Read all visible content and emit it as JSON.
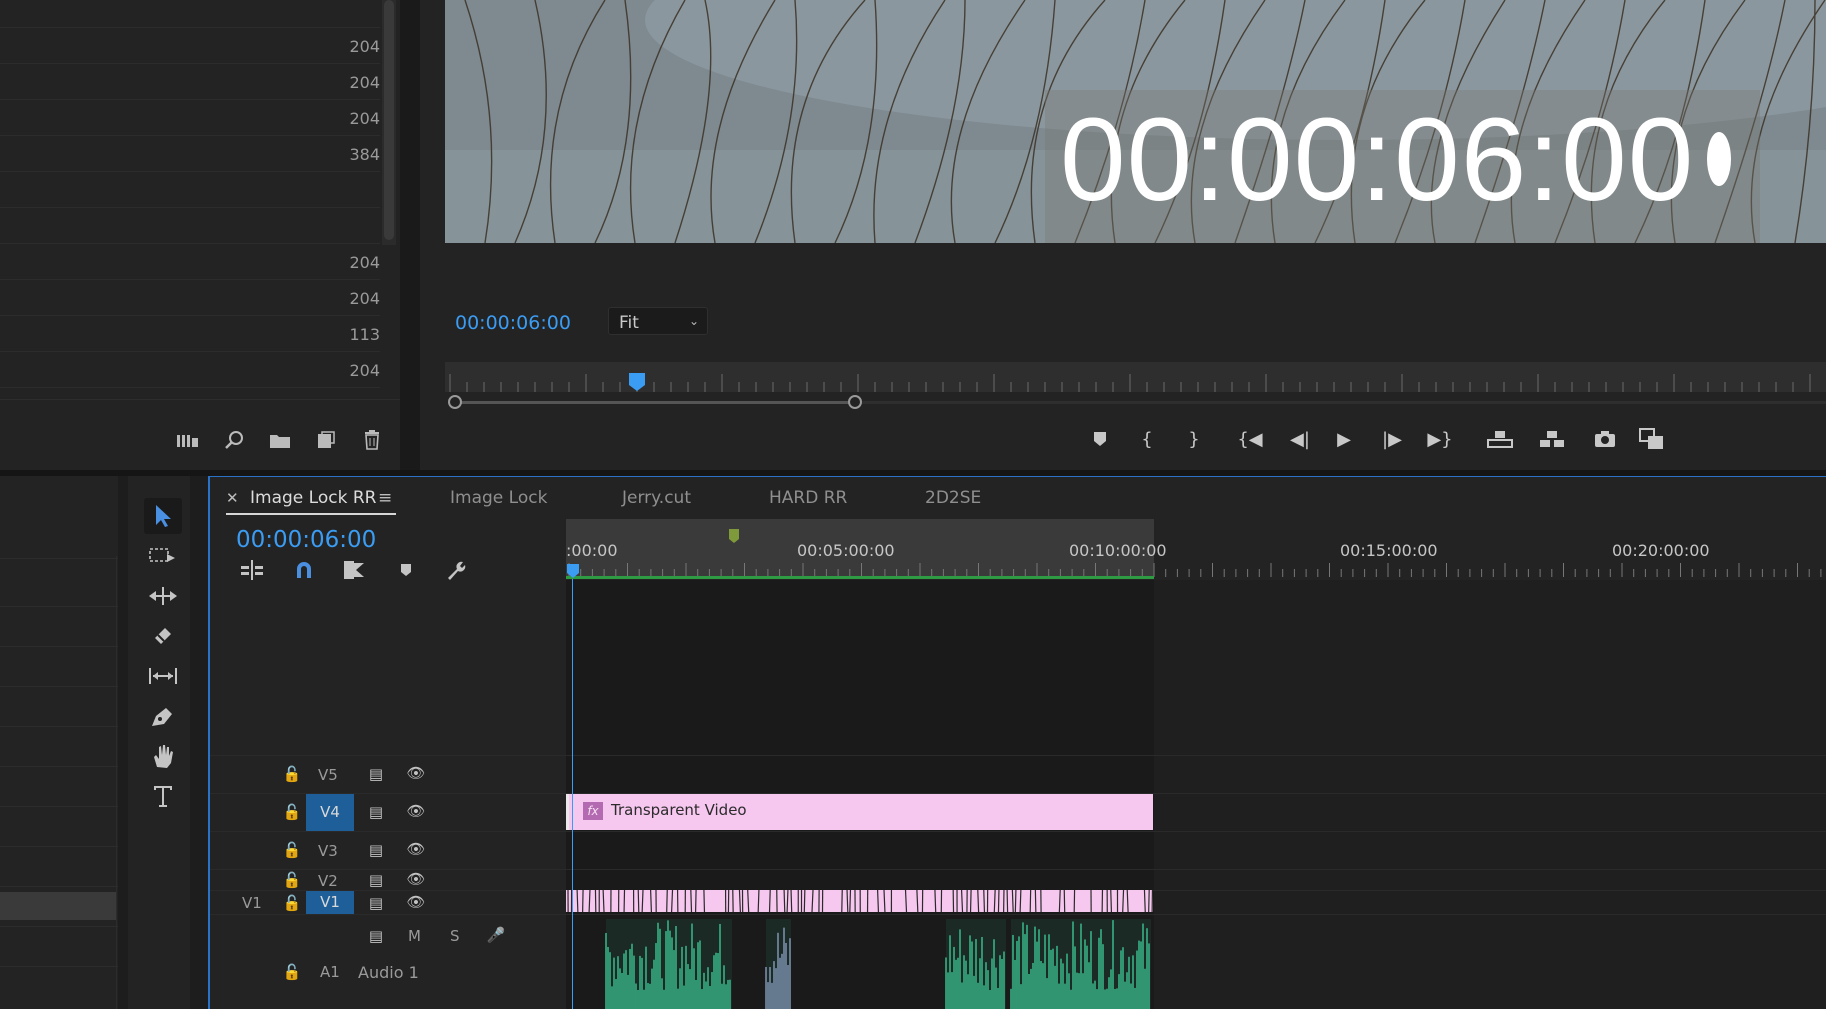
{
  "project_panel": {
    "values": [
      "204",
      "204",
      "204",
      "204",
      "384",
      "",
      "",
      "204",
      "204",
      "113",
      "204"
    ],
    "toolbar": [
      "list-view-icon",
      "search-icon",
      "new-bin-icon",
      "new-item-icon",
      "trash-icon"
    ]
  },
  "program_monitor": {
    "overlay_timecode": "00:00:06:00",
    "timecode": "00:00:06:00",
    "zoom": "Fit",
    "transport": [
      "add-marker",
      "mark-in",
      "mark-out",
      "go-to-in",
      "step-back",
      "play",
      "step-forward",
      "go-to-out",
      "lift",
      "extract",
      "export-frame",
      "button-editor"
    ]
  },
  "timeline": {
    "tabs": [
      {
        "label": "Image Lock RR",
        "active": true
      },
      {
        "label": "Image Lock",
        "active": false
      },
      {
        "label": "Jerry.cut",
        "active": false
      },
      {
        "label": "HARD RR",
        "active": false
      },
      {
        "label": "2D2SE",
        "active": false
      }
    ],
    "timecode": "00:00:06:00",
    "ruler_labels": [
      ":00:00",
      "00:05:00:00",
      "00:10:00:00",
      "00:15:00:00",
      "00:20:00:00"
    ],
    "tracks": [
      {
        "label": "V5",
        "targeted": false
      },
      {
        "label": "V4",
        "targeted": true
      },
      {
        "label": "V3",
        "targeted": false
      },
      {
        "label": "V2",
        "targeted": false
      },
      {
        "label": "V1",
        "targeted": true,
        "source": "V1"
      }
    ],
    "audio_track": {
      "label": "A1",
      "name": "Audio 1",
      "buttons": [
        "M",
        "S"
      ]
    },
    "clips": {
      "transparent_video": "Transparent Video",
      "fx_badge": "fx"
    }
  },
  "colors": {
    "accent_blue": "#3b9cf3",
    "track_target": "#1f5f99",
    "clip_pink": "#f6c7ef",
    "audio_green": "#3fcf9a",
    "work_area": "#2e9b43"
  }
}
